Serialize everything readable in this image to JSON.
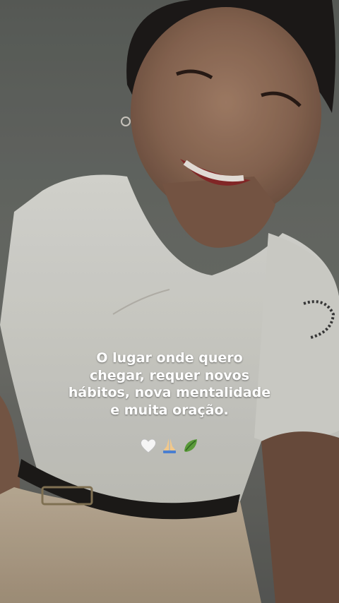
{
  "caption": {
    "lines": [
      "O lugar onde quero",
      "chegar, requer novos",
      "hábitos, nova mentalidade",
      "e muita oração."
    ]
  },
  "emojis": {
    "items": [
      "white-heart-icon",
      "praying-hands-icon",
      "leaf-icon"
    ]
  },
  "colors": {
    "caption_text": "#ffffff",
    "shirt": "#ecebe4",
    "pants": "#cbbba4",
    "belt": "#1e1c1a"
  }
}
